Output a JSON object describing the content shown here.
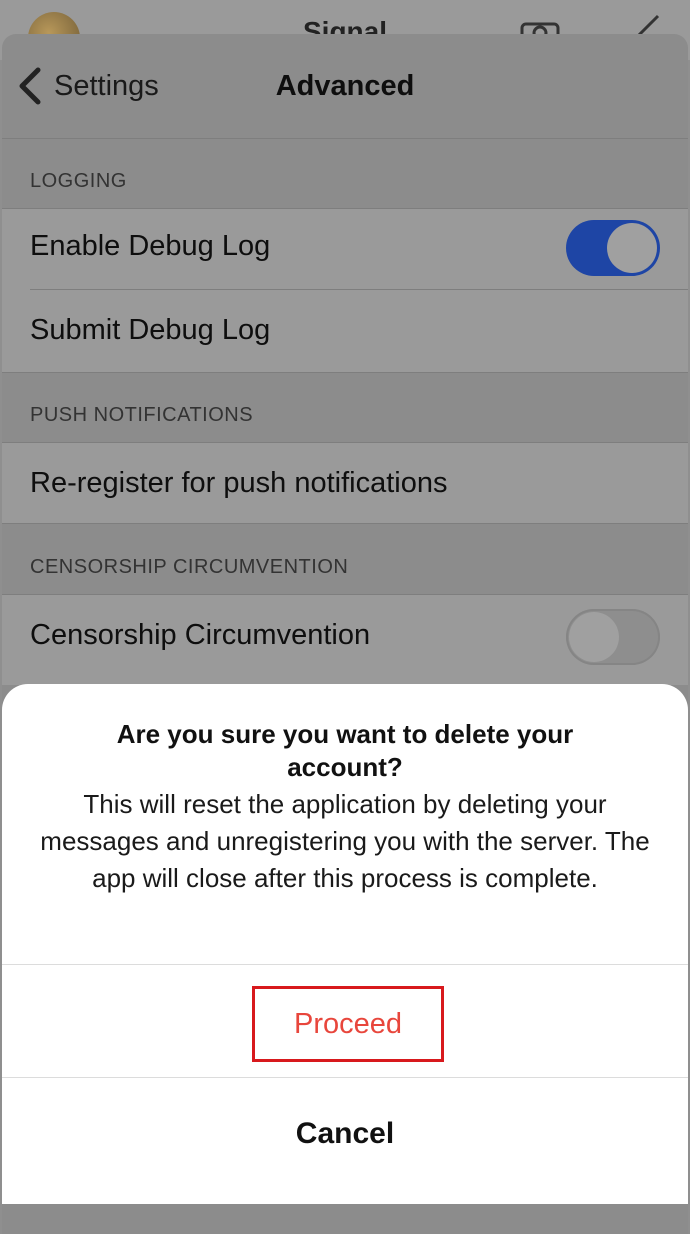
{
  "background_app": {
    "title": "Signal",
    "icons": [
      "avatar",
      "camera-icon",
      "compose-icon"
    ]
  },
  "nav": {
    "back_label": "Settings",
    "back_icon": "chevron-left-icon",
    "title": "Advanced"
  },
  "sections": [
    {
      "header": "LOGGING",
      "rows": [
        {
          "label": "Enable Debug Log",
          "toggle": true
        },
        {
          "label": "Submit Debug Log"
        }
      ]
    },
    {
      "header": "PUSH NOTIFICATIONS",
      "rows": [
        {
          "label": "Re-register for push notifications"
        }
      ]
    },
    {
      "header": "CENSORSHIP CIRCUMVENTION",
      "rows": [
        {
          "label": "Censorship Circumvention",
          "toggle": false
        }
      ]
    }
  ],
  "action_sheet": {
    "title": "Are you sure you want to delete your account?",
    "message": "This will reset the application by deleting your messages and unregistering you with the server. The app will close after this process is complete.",
    "proceed_label": "Proceed",
    "cancel_label": "Cancel"
  },
  "colors": {
    "toggle_on": "#1e45a5",
    "proceed_text": "#e8463c",
    "highlight_border": "#d8191d"
  }
}
